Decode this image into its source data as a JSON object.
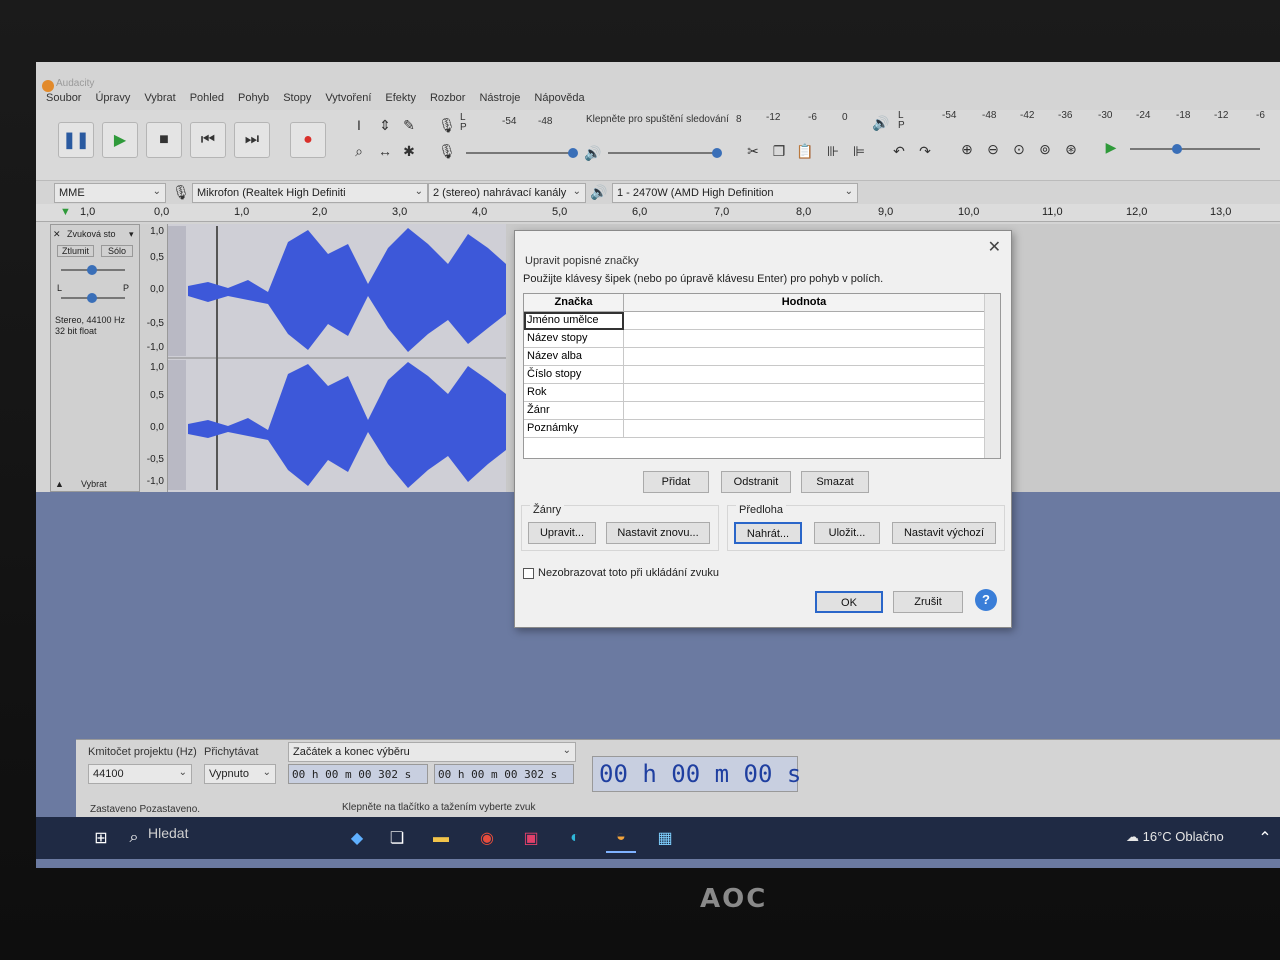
{
  "window": {
    "title": "Audacity"
  },
  "menu": [
    "Soubor",
    "Úpravy",
    "Vybrat",
    "Pohled",
    "Pohyb",
    "Stopy",
    "Vytvoření",
    "Efekty",
    "Rozbor",
    "Nástroje",
    "Nápověda"
  ],
  "meter": {
    "record_hint": "Klepněte pro spuštění sledování",
    "record_scale": [
      "-54",
      "-48",
      "8",
      "-12",
      "-6",
      "0"
    ],
    "play_scale": [
      "-54",
      "-48",
      "-42",
      "-36",
      "-30",
      "-24",
      "-18",
      "-12",
      "-6"
    ],
    "lr_top": "L",
    "lr_bottom": "P"
  },
  "devices": {
    "host": "MME",
    "mic": "Mikrofon (Realtek High Definiti",
    "channels": "2 (stereo) nahrávací kanály",
    "output": "1 - 2470W (AMD High Definition"
  },
  "ruler": [
    "1,0",
    "0,0",
    "1,0",
    "2,0",
    "3,0",
    "4,0",
    "5,0",
    "6,0",
    "7,0",
    "8,0",
    "9,0",
    "10,0",
    "11,0",
    "12,0",
    "13,0"
  ],
  "track": {
    "name": "Zvuková sto",
    "mute": "Ztlumit",
    "solo": "Sólo",
    "pan_l": "L",
    "pan_r": "P",
    "info1": "Stereo, 44100 Hz",
    "info2": "32 bit float",
    "select": "Vybrat",
    "yaxis_top": [
      "1,0",
      "0,5",
      "0,0",
      "-0,5",
      "-1,0"
    ],
    "yaxis_bottom": [
      "1,0",
      "0,5",
      "0,0",
      "-0,5",
      "-1,0"
    ]
  },
  "bottom": {
    "rate_label": "Kmitočet projektu (Hz)",
    "rate_value": "44100",
    "snap_label": "Přichytávat",
    "snap_value": "Vypnuto",
    "sel_label": "Začátek a konec výběru",
    "sel_start": "00 h 00 m 00 302 s",
    "sel_end": "00 h 00 m 00 302 s",
    "big_time": "00 h 00 m 00 s"
  },
  "status": {
    "left": "Zastaveno Pozastaveno.",
    "right": "Klepněte na tlačítko a tažením vyberte zvuk"
  },
  "taskbar": {
    "search": "Hledat",
    "weather": "16°C Oblačno"
  },
  "monitor_brand": "AOC",
  "dialog": {
    "title": "Upravit popisné značky",
    "hint": "Použijte klávesy šipek (nebo po úpravě klávesu Enter) pro pohyb v polích.",
    "col_tag": "Značka",
    "col_value": "Hodnota",
    "rows": [
      {
        "tag": "Jméno umělce",
        "value": ""
      },
      {
        "tag": "Název stopy",
        "value": ""
      },
      {
        "tag": "Název alba",
        "value": ""
      },
      {
        "tag": "Číslo stopy",
        "value": ""
      },
      {
        "tag": "Rok",
        "value": ""
      },
      {
        "tag": "Žánr",
        "value": ""
      },
      {
        "tag": "Poznámky",
        "value": ""
      }
    ],
    "btn_add": "Přidat",
    "btn_remove": "Odstranit",
    "btn_clear": "Smazat",
    "genres_label": "Žánry",
    "btn_edit": "Upravit...",
    "btn_reset": "Nastavit znovu...",
    "template_label": "Předloha",
    "btn_load": "Nahrát...",
    "btn_save": "Uložit...",
    "btn_default": "Nastavit výchozí",
    "checkbox": "Nezobrazovat toto při ukládání zvuku",
    "btn_ok": "OK",
    "btn_cancel": "Zrušit",
    "help": "?"
  }
}
